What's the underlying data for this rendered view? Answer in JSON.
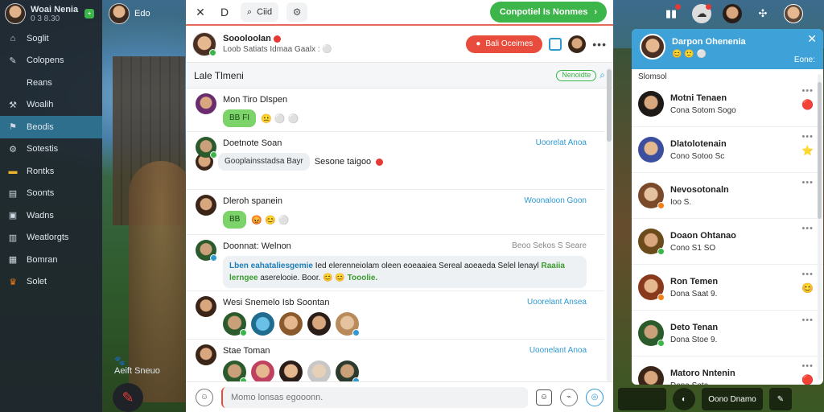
{
  "sidebar": {
    "user_name": "Woai Nenia",
    "user_sub": "0 3 8.30",
    "badge": "+",
    "items": [
      {
        "label": "Soglit",
        "icon": "home-icon"
      },
      {
        "label": "Colopens",
        "icon": "wrench-icon"
      },
      {
        "label": "Reans",
        "icon": "blank-icon"
      },
      {
        "label": "Woalih",
        "icon": "hammer-icon"
      },
      {
        "label": "Beodis",
        "icon": "flag-icon"
      },
      {
        "label": "Sotestis",
        "icon": "gear-icon"
      },
      {
        "label": "Rontks",
        "icon": "folder-icon"
      },
      {
        "label": "Soonts",
        "icon": "book-icon"
      },
      {
        "label": "Wadns",
        "icon": "bag-icon"
      },
      {
        "label": "Weatlorgts",
        "icon": "chart-icon"
      },
      {
        "label": "Bomran",
        "icon": "grid-icon"
      },
      {
        "label": "Solet",
        "icon": "trophy-icon"
      }
    ],
    "game_label": "Aeift Sneuo"
  },
  "topleft": {
    "label": "Edo"
  },
  "toolbar": {
    "search_label": "Ciid",
    "tab_label": "D",
    "green_button": "Conpotiel Is Nonmes"
  },
  "chat_header": {
    "title": "Soooloolan",
    "subtitle": "Loob Satiats Idmaa Gaalx :",
    "red_button": "Bali Oceimes"
  },
  "list_header": {
    "title": "Lale Tlmeni",
    "pill": "Nenoidte"
  },
  "messages": [
    {
      "name": "Mon Tiro Dlspen",
      "time": "",
      "bubble": "BB FI",
      "emojis": "😐 ⚪ ⚪",
      "type": "green"
    },
    {
      "name": "Doetnote Soan",
      "time": "Uoorelat Anoa",
      "sub_name": "Uaorelat Anoa",
      "bubble": "Gooplainsstadsa Bayr",
      "extra": "Sesone taigoo",
      "type": "gray"
    },
    {
      "name": "Dleroh spanein",
      "time": "Woonaloon Goon",
      "bubble": "BB",
      "emojis": "😡 😊 ⚪",
      "type": "green"
    },
    {
      "name": "Doonnat: Welnon",
      "time": "Beoo Sekos S Seare",
      "long_blue": "Lben eahataliesgemie",
      "long_text": " Ied elerenneiolam oleen eoeaaiea Sereal aoeaeda Selel lenayl",
      "long_green": " Raaiia lerngee",
      "long_tail": " aserelooie. Boor. 😊 😊 ",
      "long_green2": "Tooolie.",
      "type": "long"
    },
    {
      "name": "Wesi Snemelo Isb Soontan",
      "time": "Uoorelant Ansea",
      "type": "avatars"
    },
    {
      "name": "Stae Toman",
      "time": "Uoonelant Anoa",
      "type": "avatars2"
    }
  ],
  "input": {
    "placeholder": "Momo lonsas egooonn."
  },
  "friends": {
    "title": "Darpon Ohenenia",
    "sub": "😊 🙂 ⚪",
    "count": "Eone:",
    "section": "Slomsol",
    "list": [
      {
        "name": "Motni Tenaen",
        "status": "Cona Sotom Sogo",
        "extra": "🔴"
      },
      {
        "name": "Dlatolotenain",
        "status": "Cono Sotoo Sc",
        "extra": "⭐"
      },
      {
        "name": "Nevosotonaln",
        "status": "Ioo S.",
        "extra": ""
      },
      {
        "name": "Doaon Ohtanao",
        "status": "Cono S1 SO",
        "extra": ""
      },
      {
        "name": "Ron Temen",
        "status": "Dona Saat 9.",
        "extra": "😊"
      },
      {
        "name": "Deto Tenan",
        "status": "Dona Stoe 9.",
        "extra": ""
      },
      {
        "name": "Matoro Nntenin",
        "status": "Dona Sota",
        "extra": "🔴"
      }
    ]
  },
  "bottom_right": {
    "label": "Oono Dnamo"
  }
}
